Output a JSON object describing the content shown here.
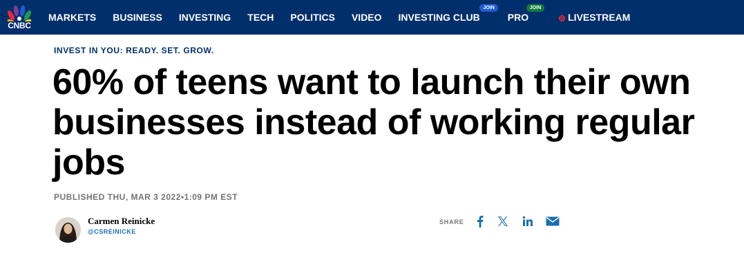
{
  "nav": {
    "logo_text": "CNBC",
    "items": [
      {
        "label": "MARKETS"
      },
      {
        "label": "BUSINESS"
      },
      {
        "label": "INVESTING"
      },
      {
        "label": "TECH"
      },
      {
        "label": "POLITICS"
      },
      {
        "label": "VIDEO"
      },
      {
        "label": "INVESTING CLUB",
        "badge": "JOIN"
      },
      {
        "label": "PRO",
        "badge": "JOIN"
      },
      {
        "label": "LIVESTREAM",
        "icon": "live-icon"
      }
    ],
    "colors": {
      "background": "#002f6c",
      "club_badge": "#1f5dd1",
      "pro_badge": "#127c3c",
      "live": "#e8273b"
    }
  },
  "article": {
    "kicker": "INVEST IN YOU: READY. SET. GROW.",
    "headline": "60% of teens want to launch their own businesses instead of working regular jobs",
    "published": "PUBLISHED THU, MAR 3 2022•1:09 PM EST"
  },
  "author": {
    "name": "Carmen Reinicke",
    "handle": "@CSREINICKE"
  },
  "share": {
    "label": "SHARE",
    "icons": [
      "facebook-icon",
      "x-icon",
      "linkedin-icon",
      "email-icon"
    ],
    "color": "#1a6fb0"
  }
}
